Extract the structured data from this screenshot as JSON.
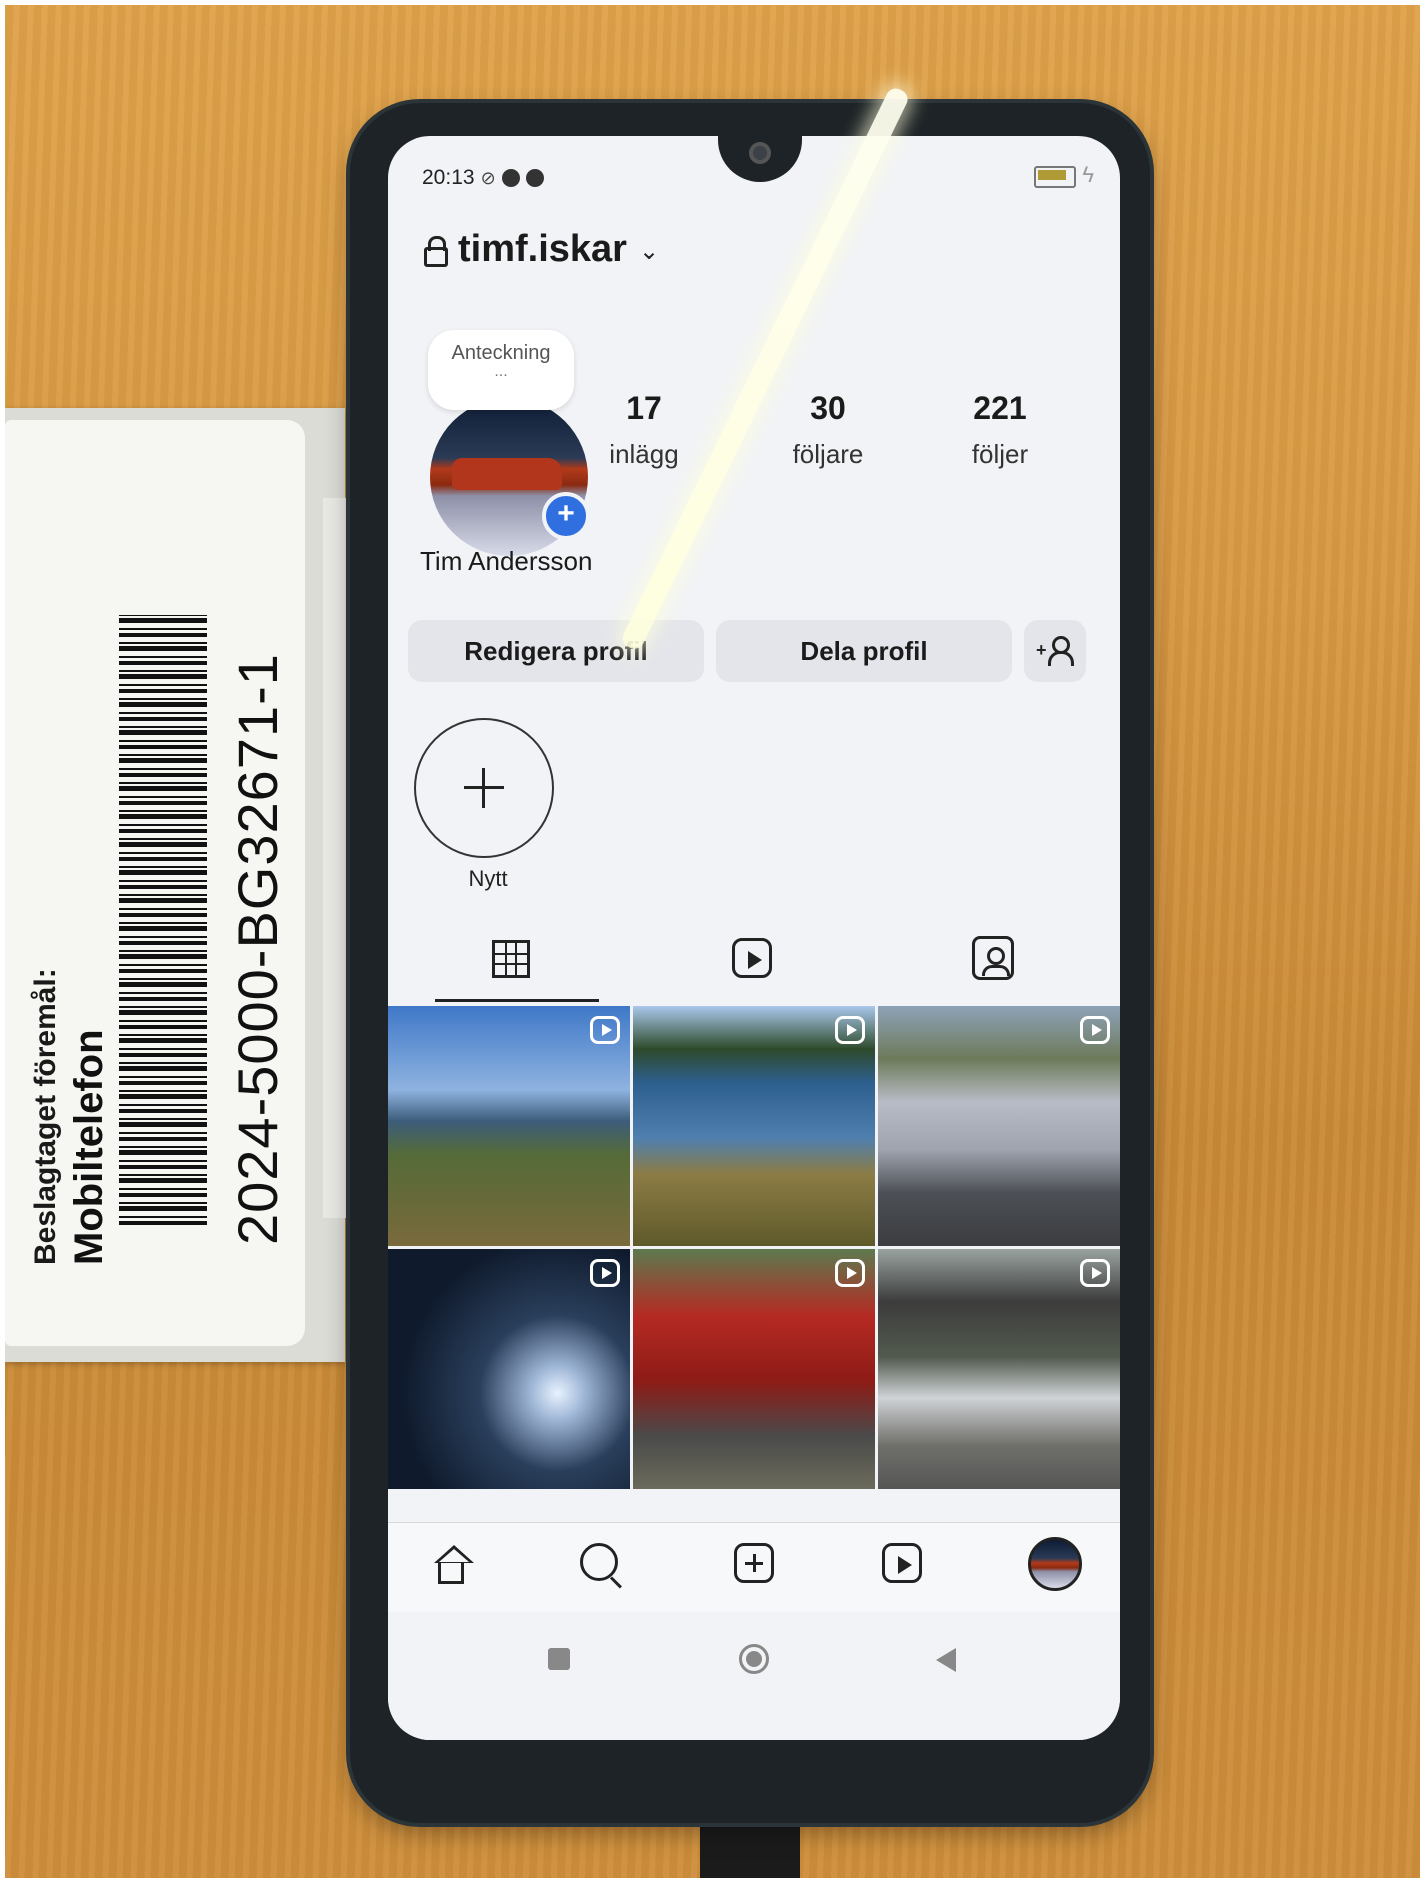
{
  "evidence_label": {
    "title": "Beslagtaget föremål:",
    "item": "Mobiltelefon",
    "number": "2024-5000-BG32671-1"
  },
  "status_bar": {
    "time": "20:13"
  },
  "profile": {
    "username": "timf.iskar",
    "note_label": "Anteckning",
    "note_dots": "...",
    "full_name": "Tim Andersson",
    "stats": [
      {
        "value": "17",
        "label": "inlägg"
      },
      {
        "value": "30",
        "label": "följare"
      },
      {
        "value": "221",
        "label": "följer"
      }
    ],
    "edit_button": "Redigera profil",
    "share_button": "Dela profil",
    "new_highlight": "Nytt"
  },
  "tabs": [
    "grid-icon",
    "reels-icon",
    "tagged-icon"
  ],
  "posts": [
    {
      "type": "reel",
      "desc": ""
    },
    {
      "type": "reel",
      "desc": ""
    },
    {
      "type": "reel",
      "desc": ""
    },
    {
      "type": "reel",
      "desc": ""
    },
    {
      "type": "reel",
      "desc": ""
    },
    {
      "type": "reel",
      "desc": ""
    }
  ],
  "colors": {
    "accent_blue": "#2f6fe0",
    "button_bg": "#e3e5ea",
    "text": "#1b1b1b"
  }
}
